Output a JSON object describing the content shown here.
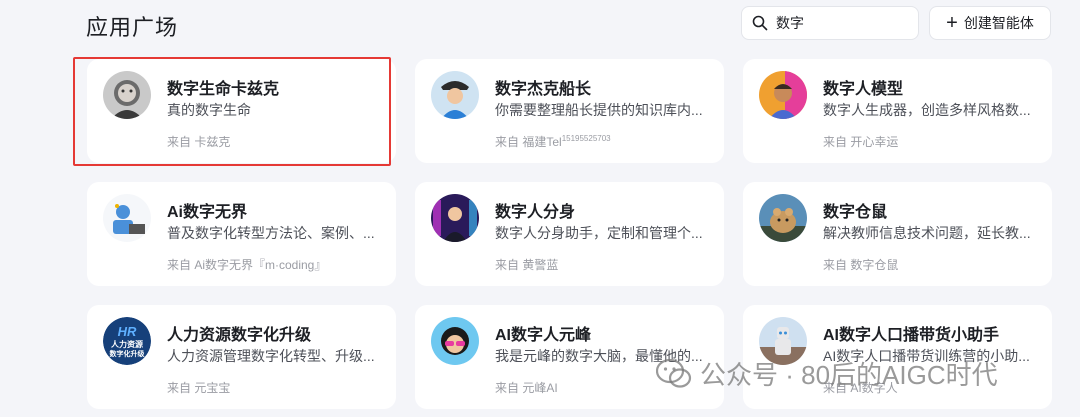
{
  "page_title": "应用广场",
  "search": {
    "value": "数字",
    "icon": "search-icon"
  },
  "create_button": {
    "label": "创建智能体",
    "icon": "plus-icon"
  },
  "apps": [
    {
      "name": "数字生命卡兹克",
      "desc": "真的数字生命",
      "source": "来自 卡兹克",
      "source_sup": "",
      "highlighted": true
    },
    {
      "name": "数字杰克船长",
      "desc": "你需要整理船长提供的知识库内...",
      "source": "来自 福建Tel",
      "source_sup": "15195525703",
      "highlighted": false
    },
    {
      "name": "数字人模型",
      "desc": "数字人生成器，创造多样风格数...",
      "source": "来自 开心幸运",
      "source_sup": "",
      "highlighted": false
    },
    {
      "name": "Ai数字无界",
      "desc": "普及数字化转型方法论、案例、...",
      "source": "来自 Ai数字无界『m·coding』",
      "source_sup": "",
      "highlighted": false
    },
    {
      "name": "数字人分身",
      "desc": "数字人分身助手，定制和管理个...",
      "source": "来自 黄警蓝",
      "source_sup": "",
      "highlighted": false
    },
    {
      "name": "数字仓鼠",
      "desc": "解决教师信息技术问题，延长教...",
      "source": "来自 数字仓鼠",
      "source_sup": "",
      "highlighted": false
    },
    {
      "name": "人力资源数字化升级",
      "desc": "人力资源管理数字化转型、升级...",
      "source": "来自 元宝宝",
      "source_sup": "",
      "highlighted": false
    },
    {
      "name": "AI数字人元峰",
      "desc": "我是元峰的数字大脑，最懂他的...",
      "source": "来自 元峰AI",
      "source_sup": "",
      "highlighted": false
    },
    {
      "name": "AI数字人口播带货小助手",
      "desc": "AI数字人口播带货训练营的小助...",
      "source": "来自 AI数字人",
      "source_sup": "",
      "highlighted": false
    }
  ],
  "avatar_logo_text": {
    "hr": "HR",
    "hr_line1": "人力资源",
    "hr_line2": "数字化升级"
  },
  "watermark": "公众号 · 80后的AIGC时代",
  "colors": {
    "background": "#f4f5f9",
    "card": "#ffffff",
    "highlight": "#e53935"
  }
}
